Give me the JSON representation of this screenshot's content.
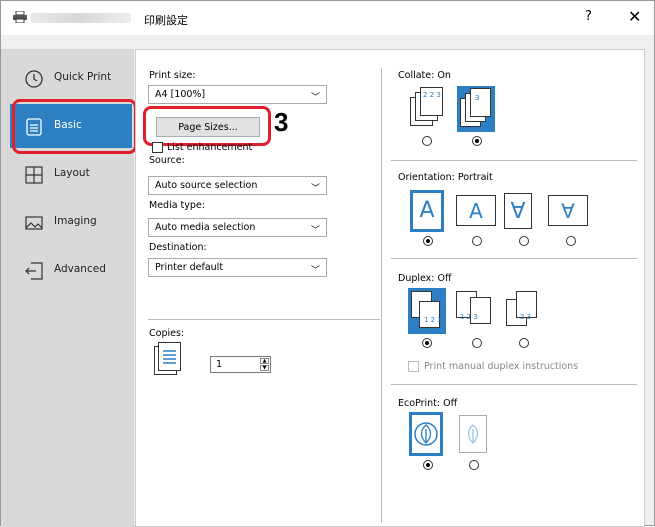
{
  "window": {
    "title": "印刷設定",
    "help": "?",
    "close": "✕"
  },
  "sidebar": {
    "items": [
      {
        "label": "Quick Print",
        "icon": "clock-icon"
      },
      {
        "label": "Basic",
        "icon": "document-icon"
      },
      {
        "label": "Layout",
        "icon": "layout-icon"
      },
      {
        "label": "Imaging",
        "icon": "image-icon"
      },
      {
        "label": "Advanced",
        "icon": "advanced-icon"
      }
    ],
    "active": "Basic"
  },
  "basic": {
    "print_size_label": "Print size:",
    "print_size_value": "A4  [100%]",
    "page_sizes_button": "Page Sizes...",
    "list_enhancement_label": "List enhancement",
    "source_label": "Source:",
    "source_value": "Auto source selection",
    "media_type_label": "Media type:",
    "media_type_value": "Auto media selection",
    "destination_label": "Destination:",
    "destination_value": "Printer default",
    "copies_label": "Copies:",
    "copies_value": "1",
    "annotation": "3"
  },
  "right": {
    "collate_label": "Collate:  On",
    "orientation_label": "Orientation:  Portrait",
    "duplex_label": "Duplex:  Off",
    "manual_duplex_label": "Print manual duplex instructions",
    "ecoprint_label": "EcoPrint:  Off",
    "orientation_glyphs": [
      "A",
      "A",
      "∀",
      "∀"
    ]
  },
  "colors": {
    "accent": "#2d7fc4",
    "highlight": "#e0202a"
  }
}
